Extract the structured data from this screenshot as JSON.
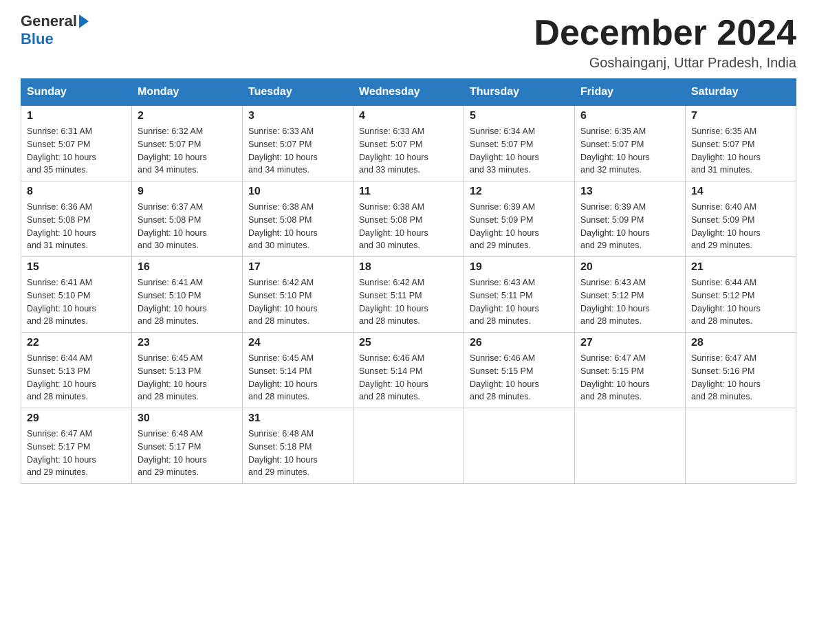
{
  "header": {
    "logo_text1": "General",
    "logo_text2": "Blue",
    "month_title": "December 2024",
    "location": "Goshainganj, Uttar Pradesh, India"
  },
  "days_of_week": [
    "Sunday",
    "Monday",
    "Tuesday",
    "Wednesday",
    "Thursday",
    "Friday",
    "Saturday"
  ],
  "weeks": [
    [
      {
        "day": "1",
        "sunrise": "6:31 AM",
        "sunset": "5:07 PM",
        "daylight": "10 hours and 35 minutes."
      },
      {
        "day": "2",
        "sunrise": "6:32 AM",
        "sunset": "5:07 PM",
        "daylight": "10 hours and 34 minutes."
      },
      {
        "day": "3",
        "sunrise": "6:33 AM",
        "sunset": "5:07 PM",
        "daylight": "10 hours and 34 minutes."
      },
      {
        "day": "4",
        "sunrise": "6:33 AM",
        "sunset": "5:07 PM",
        "daylight": "10 hours and 33 minutes."
      },
      {
        "day": "5",
        "sunrise": "6:34 AM",
        "sunset": "5:07 PM",
        "daylight": "10 hours and 33 minutes."
      },
      {
        "day": "6",
        "sunrise": "6:35 AM",
        "sunset": "5:07 PM",
        "daylight": "10 hours and 32 minutes."
      },
      {
        "day": "7",
        "sunrise": "6:35 AM",
        "sunset": "5:07 PM",
        "daylight": "10 hours and 31 minutes."
      }
    ],
    [
      {
        "day": "8",
        "sunrise": "6:36 AM",
        "sunset": "5:08 PM",
        "daylight": "10 hours and 31 minutes."
      },
      {
        "day": "9",
        "sunrise": "6:37 AM",
        "sunset": "5:08 PM",
        "daylight": "10 hours and 30 minutes."
      },
      {
        "day": "10",
        "sunrise": "6:38 AM",
        "sunset": "5:08 PM",
        "daylight": "10 hours and 30 minutes."
      },
      {
        "day": "11",
        "sunrise": "6:38 AM",
        "sunset": "5:08 PM",
        "daylight": "10 hours and 30 minutes."
      },
      {
        "day": "12",
        "sunrise": "6:39 AM",
        "sunset": "5:09 PM",
        "daylight": "10 hours and 29 minutes."
      },
      {
        "day": "13",
        "sunrise": "6:39 AM",
        "sunset": "5:09 PM",
        "daylight": "10 hours and 29 minutes."
      },
      {
        "day": "14",
        "sunrise": "6:40 AM",
        "sunset": "5:09 PM",
        "daylight": "10 hours and 29 minutes."
      }
    ],
    [
      {
        "day": "15",
        "sunrise": "6:41 AM",
        "sunset": "5:10 PM",
        "daylight": "10 hours and 28 minutes."
      },
      {
        "day": "16",
        "sunrise": "6:41 AM",
        "sunset": "5:10 PM",
        "daylight": "10 hours and 28 minutes."
      },
      {
        "day": "17",
        "sunrise": "6:42 AM",
        "sunset": "5:10 PM",
        "daylight": "10 hours and 28 minutes."
      },
      {
        "day": "18",
        "sunrise": "6:42 AM",
        "sunset": "5:11 PM",
        "daylight": "10 hours and 28 minutes."
      },
      {
        "day": "19",
        "sunrise": "6:43 AM",
        "sunset": "5:11 PM",
        "daylight": "10 hours and 28 minutes."
      },
      {
        "day": "20",
        "sunrise": "6:43 AM",
        "sunset": "5:12 PM",
        "daylight": "10 hours and 28 minutes."
      },
      {
        "day": "21",
        "sunrise": "6:44 AM",
        "sunset": "5:12 PM",
        "daylight": "10 hours and 28 minutes."
      }
    ],
    [
      {
        "day": "22",
        "sunrise": "6:44 AM",
        "sunset": "5:13 PM",
        "daylight": "10 hours and 28 minutes."
      },
      {
        "day": "23",
        "sunrise": "6:45 AM",
        "sunset": "5:13 PM",
        "daylight": "10 hours and 28 minutes."
      },
      {
        "day": "24",
        "sunrise": "6:45 AM",
        "sunset": "5:14 PM",
        "daylight": "10 hours and 28 minutes."
      },
      {
        "day": "25",
        "sunrise": "6:46 AM",
        "sunset": "5:14 PM",
        "daylight": "10 hours and 28 minutes."
      },
      {
        "day": "26",
        "sunrise": "6:46 AM",
        "sunset": "5:15 PM",
        "daylight": "10 hours and 28 minutes."
      },
      {
        "day": "27",
        "sunrise": "6:47 AM",
        "sunset": "5:15 PM",
        "daylight": "10 hours and 28 minutes."
      },
      {
        "day": "28",
        "sunrise": "6:47 AM",
        "sunset": "5:16 PM",
        "daylight": "10 hours and 28 minutes."
      }
    ],
    [
      {
        "day": "29",
        "sunrise": "6:47 AM",
        "sunset": "5:17 PM",
        "daylight": "10 hours and 29 minutes."
      },
      {
        "day": "30",
        "sunrise": "6:48 AM",
        "sunset": "5:17 PM",
        "daylight": "10 hours and 29 minutes."
      },
      {
        "day": "31",
        "sunrise": "6:48 AM",
        "sunset": "5:18 PM",
        "daylight": "10 hours and 29 minutes."
      },
      null,
      null,
      null,
      null
    ]
  ],
  "labels": {
    "sunrise": "Sunrise:",
    "sunset": "Sunset:",
    "daylight": "Daylight:"
  }
}
